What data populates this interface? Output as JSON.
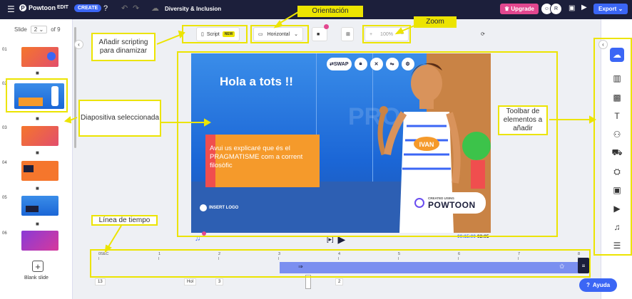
{
  "topbar": {
    "app_name": "Powtoon",
    "edit_label": "EDIT",
    "create_label": "CREATE",
    "title": "Diversity & Inclusion",
    "upgrade_label": "Upgrade",
    "avatar_r": "R",
    "export_label": "Export"
  },
  "left_panel": {
    "slide_label": "Slide",
    "slide_current": "2",
    "slide_total": "of 9",
    "thumbs": [
      "01",
      "02",
      "03",
      "04",
      "05",
      "06"
    ],
    "blank_slide_label": "Blank slide"
  },
  "canvas_toolbar": {
    "script_label": "Script",
    "new_badge": "NEW",
    "orientation_value": "Horizontal",
    "zoom_value": "100%"
  },
  "canvas": {
    "heading": "Hola a tots !!",
    "body_text": "Avui us explicaré que és el PRAGMATISME com a corrent filosòfic",
    "insert_logo": "INSERT LOGO",
    "created_using": "CREATED USING",
    "powtoon_brand": "POWTOON",
    "character_tag": "IVAN",
    "swap_label": "SWAP",
    "watermark": "PRO"
  },
  "playback": {
    "current_time": "00:15:00",
    "total_time": "02:05"
  },
  "timeline": {
    "ticks": [
      "0SEC",
      "1",
      "2",
      "3",
      "4",
      "5",
      "6",
      "7",
      "8"
    ],
    "chips": [
      "13",
      "Hol",
      "3",
      "2"
    ]
  },
  "help": {
    "ayuda_label": "Ayuda"
  },
  "profile": {
    "initials": "HL"
  },
  "annotations": {
    "orientacion": "Orientación",
    "zoom": "Zoom",
    "scripting": "Añadir scripting para dinamizar",
    "diapositiva": "Diapositiva seleccionada",
    "toolbar": "Toolbar de elementos a añadir",
    "linea": "Línea de tiempo"
  },
  "colors": {
    "topbar": "#1c1f3b",
    "accent": "#3b66f5",
    "upgrade": "#e2478f",
    "annotation": "#ece400"
  }
}
